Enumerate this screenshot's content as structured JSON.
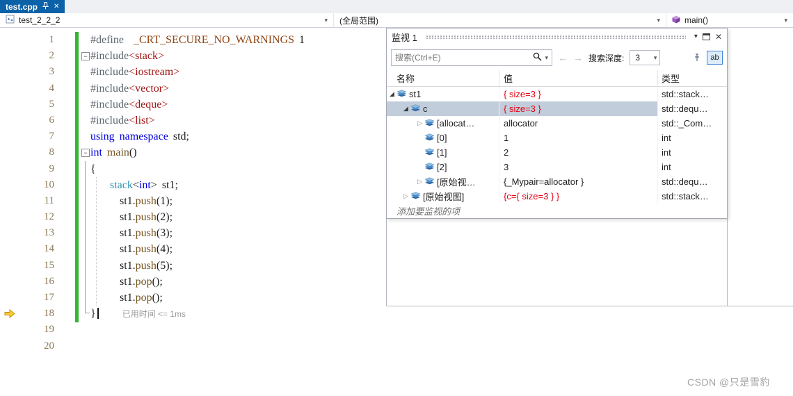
{
  "window": {
    "tab_title": "test.cpp"
  },
  "navbar": {
    "project": "test_2_2_2",
    "scope": "(全局范围)",
    "member": "main()"
  },
  "icons": {
    "dropdown": "▾",
    "close": "✕",
    "back": "←",
    "forward": "→",
    "fold_collapse": "−",
    "expander_expanded": "◢",
    "expander_collapsed": "▷"
  },
  "editor": {
    "perf_tip": "已用时间 <= 1ms",
    "exec_line": 18,
    "change_bar": {
      "start": 1,
      "end": 18
    },
    "fold_boxes": [
      2,
      8
    ],
    "fold_span": {
      "start": 9,
      "end": 18
    },
    "indent_guide": {
      "start": 10,
      "end": 17
    },
    "lines": [
      {
        "n": 1,
        "t": [
          [
            "pp",
            "#define"
          ],
          [
            "plain",
            "  "
          ],
          [
            "macro",
            "_CRT_SECURE_NO_WARNINGS"
          ],
          [
            "plain",
            " 1"
          ]
        ]
      },
      {
        "n": 2,
        "t": [
          [
            "pp",
            "#include"
          ],
          [
            "inc",
            "<stack>"
          ]
        ]
      },
      {
        "n": 3,
        "t": [
          [
            "pp",
            "#include"
          ],
          [
            "inc",
            "<iostream>"
          ]
        ]
      },
      {
        "n": 4,
        "t": [
          [
            "pp",
            "#include"
          ],
          [
            "inc",
            "<vector>"
          ]
        ]
      },
      {
        "n": 5,
        "t": [
          [
            "pp",
            "#include"
          ],
          [
            "inc",
            "<deque>"
          ]
        ]
      },
      {
        "n": 6,
        "t": [
          [
            "pp",
            "#include"
          ],
          [
            "inc",
            "<list>"
          ]
        ]
      },
      {
        "n": 7,
        "t": [
          [
            "kw",
            "using"
          ],
          [
            "plain",
            " "
          ],
          [
            "kw",
            "namespace"
          ],
          [
            "plain",
            " std;"
          ]
        ]
      },
      {
        "n": 8,
        "t": [
          [
            "kw",
            "int"
          ],
          [
            "plain",
            " "
          ],
          [
            "fn",
            "main"
          ],
          [
            "plain",
            "()"
          ]
        ]
      },
      {
        "n": 9,
        "t": [
          [
            "plain",
            "{"
          ]
        ]
      },
      {
        "n": 10,
        "t": [
          [
            "plain",
            "    "
          ],
          [
            "typeName",
            "stack"
          ],
          [
            "plain",
            "<"
          ],
          [
            "kw",
            "int"
          ],
          [
            "plain",
            "> st1;"
          ]
        ]
      },
      {
        "n": 11,
        "t": [
          [
            "plain",
            "      st1."
          ],
          [
            "fn",
            "push"
          ],
          [
            "plain",
            "(1);"
          ]
        ]
      },
      {
        "n": 12,
        "t": [
          [
            "plain",
            "      st1."
          ],
          [
            "fn",
            "push"
          ],
          [
            "plain",
            "(2);"
          ]
        ]
      },
      {
        "n": 13,
        "t": [
          [
            "plain",
            "      st1."
          ],
          [
            "fn",
            "push"
          ],
          [
            "plain",
            "(3);"
          ]
        ]
      },
      {
        "n": 14,
        "t": [
          [
            "plain",
            "      st1."
          ],
          [
            "fn",
            "push"
          ],
          [
            "plain",
            "(4);"
          ]
        ]
      },
      {
        "n": 15,
        "t": [
          [
            "plain",
            "      st1."
          ],
          [
            "fn",
            "push"
          ],
          [
            "plain",
            "(5);"
          ]
        ]
      },
      {
        "n": 16,
        "t": [
          [
            "plain",
            "      st1."
          ],
          [
            "fn",
            "pop"
          ],
          [
            "plain",
            "();"
          ]
        ]
      },
      {
        "n": 17,
        "t": [
          [
            "plain",
            "      st1."
          ],
          [
            "fn",
            "pop"
          ],
          [
            "plain",
            "();"
          ]
        ]
      },
      {
        "n": 18,
        "t": [
          [
            "plain",
            "}"
          ]
        ],
        "caret": true,
        "perf": true
      },
      {
        "n": 19,
        "t": []
      },
      {
        "n": 20,
        "t": []
      }
    ]
  },
  "watch": {
    "title": "监视 1",
    "search_placeholder": "搜索(Ctrl+E)",
    "depth_label": "搜索深度:",
    "depth_value": "3",
    "format_toggle_label": "ab",
    "columns": [
      "名称",
      "值",
      "类型"
    ],
    "rows": [
      {
        "name": "st1",
        "value": "{ size=3 }",
        "type": "std::stack…",
        "level": 0,
        "expander": "expanded",
        "value_red": true,
        "selected": false
      },
      {
        "name": "c",
        "value": "{ size=3 }",
        "type": "std::dequ…",
        "level": 1,
        "expander": "expanded",
        "value_red": true,
        "selected": true
      },
      {
        "name": "[allocat…",
        "value": "allocator",
        "type": "std::_Com…",
        "level": 2,
        "expander": "collapsed",
        "value_red": false,
        "selected": false
      },
      {
        "name": "[0]",
        "value": "1",
        "type": "int",
        "level": 2,
        "expander": "none",
        "value_red": false,
        "selected": false
      },
      {
        "name": "[1]",
        "value": "2",
        "type": "int",
        "level": 2,
        "expander": "none",
        "value_red": false,
        "selected": false
      },
      {
        "name": "[2]",
        "value": "3",
        "type": "int",
        "level": 2,
        "expander": "none",
        "value_red": false,
        "selected": false
      },
      {
        "name": "[原始视…",
        "value": "{_Mypair=allocator }",
        "type": "std::dequ…",
        "level": 2,
        "expander": "collapsed",
        "value_red": false,
        "selected": false
      },
      {
        "name": "[原始视图]",
        "value": "{c={ size=3 } }",
        "type": "std::stack…",
        "level": 1,
        "expander": "collapsed",
        "value_red": true,
        "selected": false
      }
    ],
    "add_row_label": "添加要监视的项"
  },
  "watermark": "CSDN @只是雪豹",
  "colors": {
    "tabBg": "#0b62a8",
    "topBg": "#eef0f4",
    "navBorder": "#ccd0da",
    "kw": "#0000e0",
    "typeName": "#2b91af",
    "fn": "#74531f",
    "inc": "#a31515",
    "macro": "#8f4512",
    "pp": "#5d6670",
    "plain": "#1c1c1c",
    "lineNum": "#8c7a58",
    "changeBar": "#35b435",
    "selRow": "#c2cddb",
    "valRed": "#e60012",
    "watchBorder": "#a4a9b4",
    "frameBorder": "#b4b6bf",
    "grayText": "#9c9c9c",
    "arrowFill": "#f8cc3a",
    "arrowStroke": "#c2930e",
    "toggleBorder": "#3f85d6",
    "toggleBg": "#dcecfb"
  }
}
